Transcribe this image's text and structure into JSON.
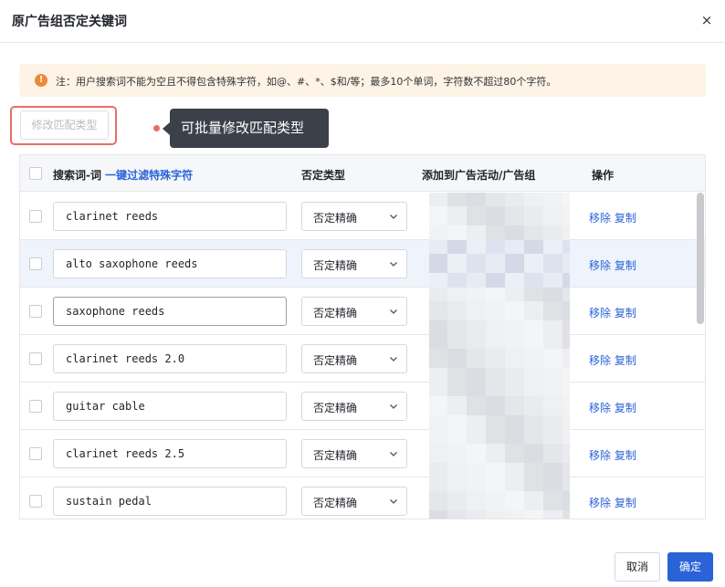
{
  "dialog": {
    "title": "原广告组否定关键词",
    "close_icon": "×"
  },
  "notice": {
    "icon": "!",
    "text": "注：用户搜索词不能为空且不得包含特殊字符，如@、#、*、$和/等；最多10个单词，字符数不超过80个字符。"
  },
  "toolbar": {
    "modify_match_type_label": "修改匹配类型",
    "tooltip_text": "可批量修改匹配类型"
  },
  "table": {
    "headers": {
      "search_term": "搜索词-词",
      "filter_special_link": "一键过滤特殊字符",
      "negative_type": "否定类型",
      "add_to_campaign": "添加到广告活动/广告组",
      "actions": "操作"
    },
    "rows": [
      {
        "keyword": "clarinet reeds",
        "match_type": "否定精确",
        "remove_label": "移除",
        "copy_label": "复制"
      },
      {
        "keyword": "alto saxophone reeds",
        "match_type": "否定精确",
        "remove_label": "移除",
        "copy_label": "复制"
      },
      {
        "keyword": "saxophone reeds",
        "match_type": "否定精确",
        "remove_label": "移除",
        "copy_label": "复制"
      },
      {
        "keyword": "clarinet reeds 2.0",
        "match_type": "否定精确",
        "remove_label": "移除",
        "copy_label": "复制"
      },
      {
        "keyword": "guitar cable",
        "match_type": "否定精确",
        "remove_label": "移除",
        "copy_label": "复制"
      },
      {
        "keyword": "clarinet reeds 2.5",
        "match_type": "否定精确",
        "remove_label": "移除",
        "copy_label": "复制"
      },
      {
        "keyword": "sustain pedal",
        "match_type": "否定精确",
        "remove_label": "移除",
        "copy_label": "复制"
      }
    ]
  },
  "footer": {
    "cancel_label": "取消",
    "ok_label": "确定"
  },
  "colors": {
    "primary": "#2a63d8",
    "notice_bg": "#fdf3e6",
    "notice_icon": "#f0883a",
    "highlight": "#e76e6b",
    "tooltip_bg": "#3c4048"
  },
  "icons": {
    "warning": "warning-icon",
    "close": "close-icon",
    "dropdown": "chevron-down-icon"
  }
}
